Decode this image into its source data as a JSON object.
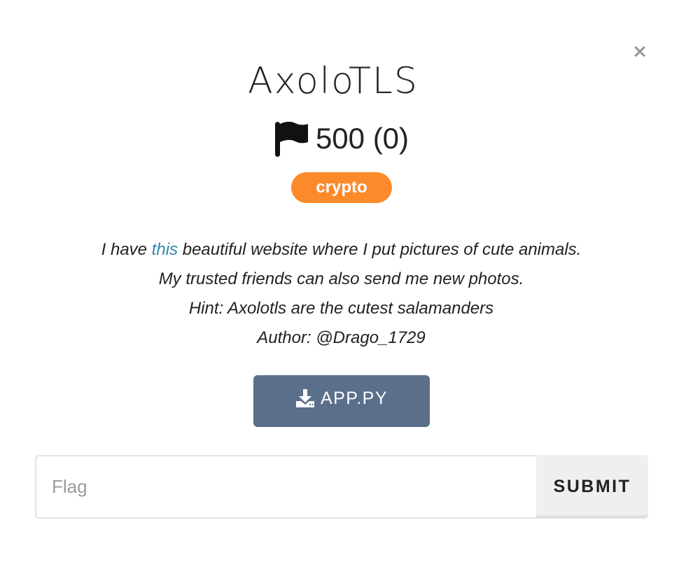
{
  "modal": {
    "close_label": "×",
    "title": "AxoloTLS",
    "points_text": "500 (0)",
    "category_badge": "crypto",
    "category_color": "#fd8a2a",
    "description": {
      "line1_before": "I have ",
      "line1_link": "this",
      "line1_after": " beautiful website where I put pictures of cute animals.",
      "line2": "My trusted friends can also send me new photos.",
      "line3": "Hint: Axolotls are the cutest salamanders",
      "line4": "Author: @Drago_1729"
    },
    "download": {
      "icon": "download-icon",
      "label": "APP.PY"
    },
    "flag_form": {
      "placeholder": "Flag",
      "value": "",
      "submit_label": "SUBMIT"
    }
  },
  "colors": {
    "link": "#2f86ad",
    "download_button": "#5b6f8b",
    "submit_button": "#efefef"
  }
}
